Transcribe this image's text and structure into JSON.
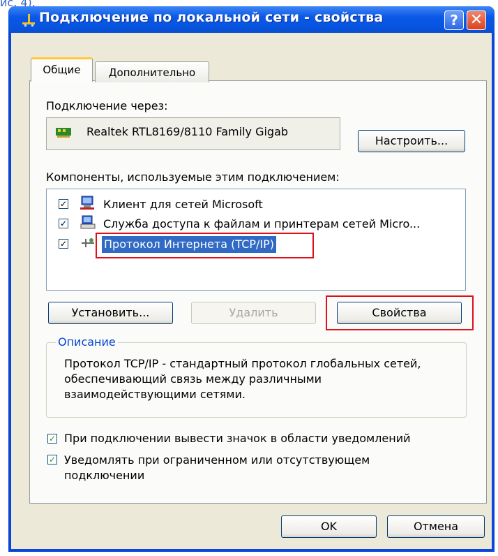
{
  "page_caption": "ис. 4).",
  "dialog": {
    "title": "Подключение по локальной сети - свойства",
    "help_label": "?",
    "close_label": "✕"
  },
  "tabs": [
    {
      "label": "Общие",
      "active": true
    },
    {
      "label": "Дополнительно",
      "active": false
    }
  ],
  "connect_via": {
    "label": "Подключение через:",
    "adapter": "Realtek RTL8169/8110 Family Gigab",
    "configure_button": "Настроить..."
  },
  "components": {
    "label": "Компоненты, используемые этим подключением:",
    "items": [
      {
        "label": "Клиент для сетей Microsoft",
        "checked": true,
        "icon": "network-client-icon"
      },
      {
        "label": "Служба доступа к файлам и принтерам сетей Micro...",
        "checked": true,
        "icon": "file-printer-service-icon"
      },
      {
        "label": "Протокол Интернета (TCP/IP)",
        "checked": true,
        "selected": true,
        "icon": "protocol-icon"
      }
    ]
  },
  "buttons": {
    "install": "Установить...",
    "remove": "Удалить",
    "properties": "Свойства",
    "ok": "OK",
    "cancel": "Отмена"
  },
  "description": {
    "legend": "Описание",
    "text": "Протокол TCP/IP - стандартный протокол глобальных сетей, обеспечивающий связь между различными взаимодействующими сетями."
  },
  "options": [
    {
      "label": "При подключении вывести значок в области уведомлений",
      "checked": true
    },
    {
      "label": "Уведомлять при ограниченном или отсутствующем подключении",
      "checked": true
    }
  ],
  "colors": {
    "titlebar": "#0a58e8",
    "selection": "#316ac5",
    "highlight_box": "#e0101a",
    "legend_text": "#0046d5"
  }
}
